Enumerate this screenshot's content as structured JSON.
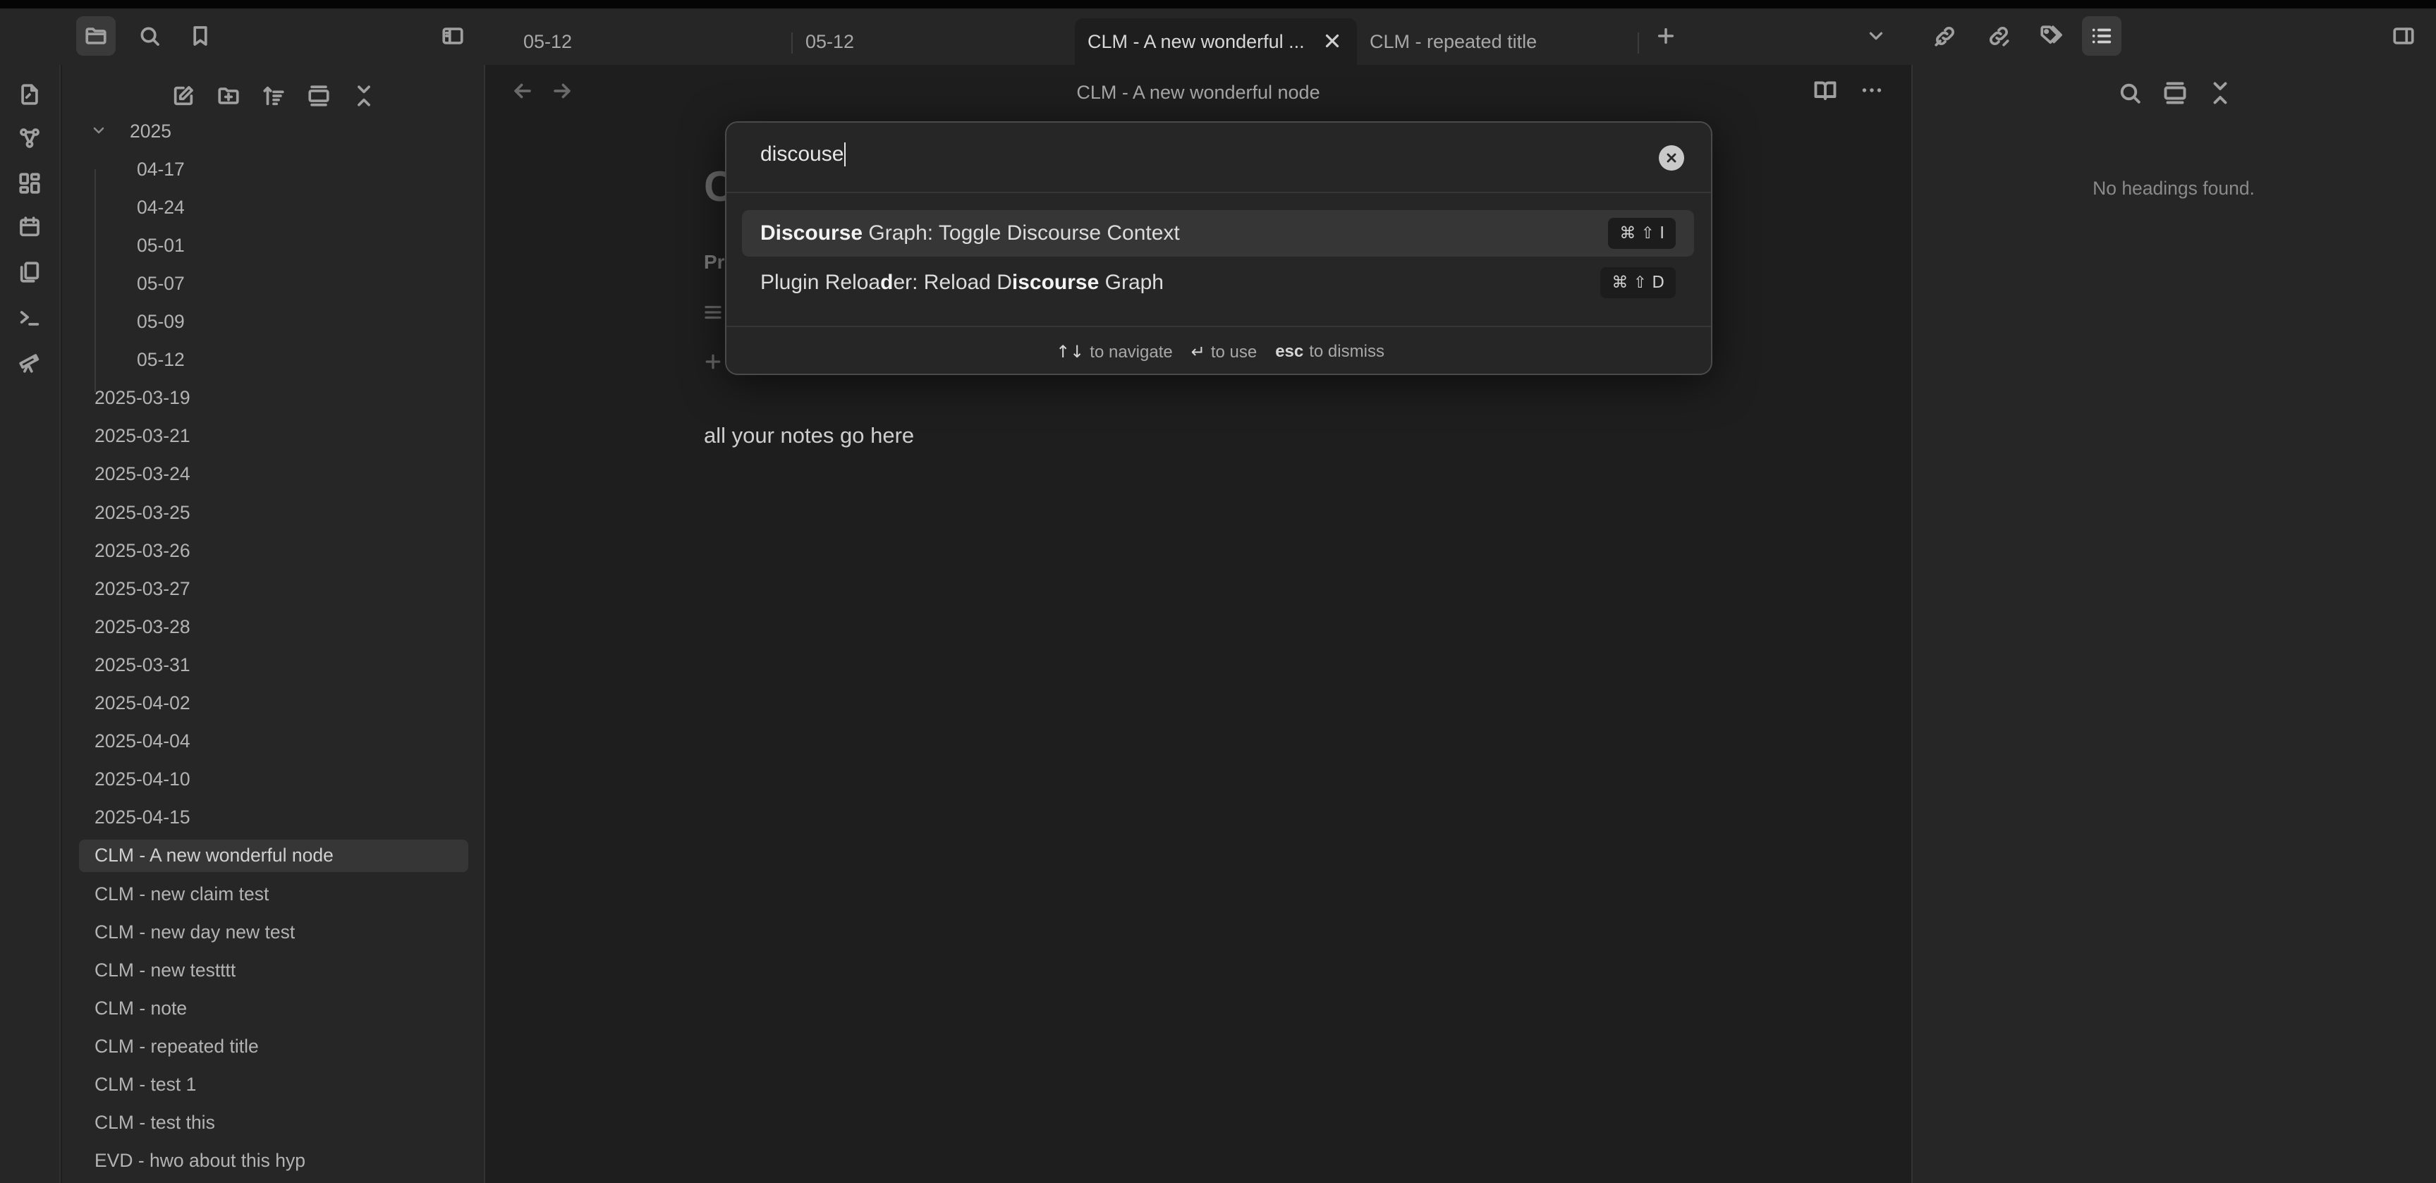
{
  "tabs": [
    {
      "label": "05-12",
      "active": false
    },
    {
      "label": "05-12",
      "active": false
    },
    {
      "label": "CLM - A new wonderful ...",
      "active": true
    },
    {
      "label": "CLM - repeated title",
      "active": false
    }
  ],
  "explorer": {
    "folder": "2025",
    "children": [
      "04-17",
      "04-24",
      "05-01",
      "05-07",
      "05-09",
      "05-12"
    ],
    "files": [
      "2025-03-19",
      "2025-03-21",
      "2025-03-24",
      "2025-03-25",
      "2025-03-26",
      "2025-03-27",
      "2025-03-28",
      "2025-03-31",
      "2025-04-02",
      "2025-04-04",
      "2025-04-10",
      "2025-04-15",
      "CLM - A new wonderful node",
      "CLM - new claim test",
      "CLM - new day new test",
      "CLM - new testttt",
      "CLM - note",
      "CLM - repeated title",
      "CLM - test 1",
      "CLM - test this",
      "EVD - hwo about this hyp"
    ],
    "selected_file": "CLM - A new wonderful node"
  },
  "editor": {
    "title": "CLM - A new wonderful node",
    "heading_partial": "C",
    "property_partial": "Pr",
    "body_text": "all your notes go here"
  },
  "outline": {
    "empty_message": "No headings found."
  },
  "palette": {
    "query": "discouse",
    "suggestions": [
      {
        "parts": [
          {
            "t": "Discourse",
            "b": true
          },
          {
            "t": " Graph: Toggle Discourse Context",
            "b": false
          }
        ],
        "hotkey": "⌘ ⇧ I",
        "selected": true
      },
      {
        "parts": [
          {
            "t": "Plugin Reloa",
            "b": false
          },
          {
            "t": "d",
            "b": true
          },
          {
            "t": "er: Reload D",
            "b": false
          },
          {
            "t": "iscourse",
            "b": true
          },
          {
            "t": " Graph",
            "b": false
          }
        ],
        "hotkey": "⌘ ⇧ D",
        "selected": false
      }
    ],
    "footer": {
      "navigate_key": "↑↓",
      "navigate_label": "to navigate",
      "use_key": "↵",
      "use_label": "to use",
      "dismiss_key": "esc",
      "dismiss_label": "to dismiss"
    }
  }
}
